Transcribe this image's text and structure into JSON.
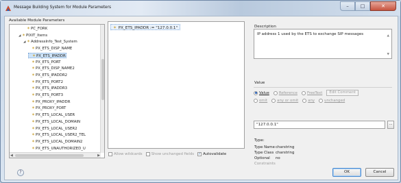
{
  "window": {
    "title": "Message Building System for Module Parameters"
  },
  "tree": {
    "label": "Available Module Parameters",
    "items": [
      {
        "label": "PC_FORK",
        "depth": 2
      },
      {
        "label": "PIXIT_Items",
        "depth": 1,
        "expander": "◢"
      },
      {
        "label": "AddressInfo_Test_System",
        "depth": 2,
        "expander": "◢"
      },
      {
        "label": "PX_ETS_DISP_NAME",
        "depth": 3
      },
      {
        "label": "PX_ETS_IPADDR",
        "depth": 3,
        "selected": true
      },
      {
        "label": "PX_ETS_PORT",
        "depth": 3
      },
      {
        "label": "PX_ETS_DISP_NAME2",
        "depth": 3
      },
      {
        "label": "PX_ETS_IPADDR2",
        "depth": 3
      },
      {
        "label": "PX_ETS_PORT2",
        "depth": 3
      },
      {
        "label": "PX_ETS_IPADDR3",
        "depth": 3
      },
      {
        "label": "PX_ETS_PORT3",
        "depth": 3
      },
      {
        "label": "PX_PROXY_IPADDR",
        "depth": 3
      },
      {
        "label": "PX_PROXY_PORT",
        "depth": 3
      },
      {
        "label": "PX_ETS_LOCAL_USER",
        "depth": 3
      },
      {
        "label": "PX_ETS_LOCAL_DOMAIN",
        "depth": 3
      },
      {
        "label": "PX_ETS_LOCAL_USER2",
        "depth": 3
      },
      {
        "label": "PX_ETS_LOCAL_USER2_TEL",
        "depth": 3
      },
      {
        "label": "PX_ETS_LOCAL_DOMAIN2",
        "depth": 3
      },
      {
        "label": "PX_ETS_UNAUTHORIZED_U",
        "depth": 3
      }
    ]
  },
  "middle": {
    "item": "PX_ETS_IPADDR := \"127.0.0.1\"",
    "options": {
      "allow_wildcards": "Allow wildcards",
      "show_unchanged": "Show unchanged fields",
      "autovalidate": "Autovalidate"
    }
  },
  "description": {
    "title": "Description",
    "text": "IP address 1 used by the ETS to exchange SIP messages"
  },
  "value": {
    "title": "Value",
    "radios_row1": {
      "value": "Value",
      "reference": "Reference",
      "freetext": "FreeText"
    },
    "edit_comment": "Edit Comment",
    "radios_row2": {
      "omit": "omit",
      "any_or_omit": "any or omit",
      "any": "any",
      "unchanged": "unchanged"
    },
    "input_value": "\"127.0.0.1\"",
    "browse": "..."
  },
  "type": {
    "title": "Type:",
    "rows": [
      {
        "k": "Type Name",
        "v": "charstring"
      },
      {
        "k": "Type Class",
        "v": "charstring"
      },
      {
        "k": "Optional",
        "v": "no"
      },
      {
        "k": "Constraints",
        "v": ""
      }
    ]
  },
  "buttons": {
    "help": "?",
    "ok": "OK",
    "cancel": "Cancel"
  },
  "colors": {
    "selection": "#cde3f7",
    "accent": "#2a62b8"
  }
}
